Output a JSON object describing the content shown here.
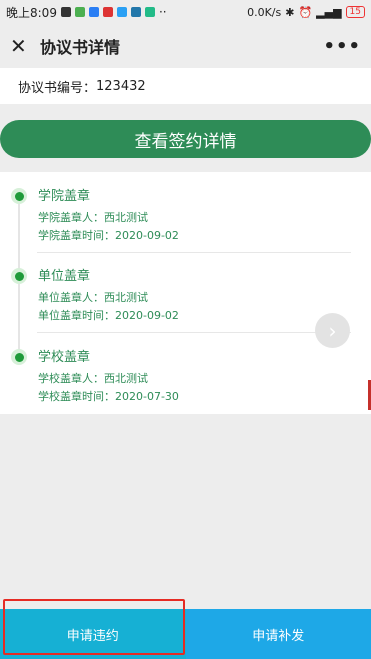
{
  "status": {
    "time": "晚上8:09",
    "speed": "0.0K/s",
    "battery": "15"
  },
  "nav": {
    "title": "协议书详情",
    "more": "•••"
  },
  "agreement": {
    "label": "协议书编号：",
    "number": "123432"
  },
  "main_button": "查看签约详情",
  "timeline": [
    {
      "title": "学院盖章",
      "line1": "学院盖章人：西北测试",
      "line2": "学院盖章时间：2020-09-02"
    },
    {
      "title": "单位盖章",
      "line1": "单位盖章人：西北测试",
      "line2": "单位盖章时间：2020-09-02"
    },
    {
      "title": "学校盖章",
      "line1": "学校盖章人：西北测试",
      "line2": "学校盖章时间：2020-07-30"
    }
  ],
  "bottom": {
    "left": "申请违约",
    "right": "申请补发"
  },
  "colors": {
    "accent_green": "#2e8c57",
    "highlight_red": "#e52b24",
    "bottom_left": "#16b0d4",
    "bottom_right": "#1ea8e7"
  },
  "icons": [
    "close-icon",
    "more-icon",
    "chevron-right-icon"
  ]
}
